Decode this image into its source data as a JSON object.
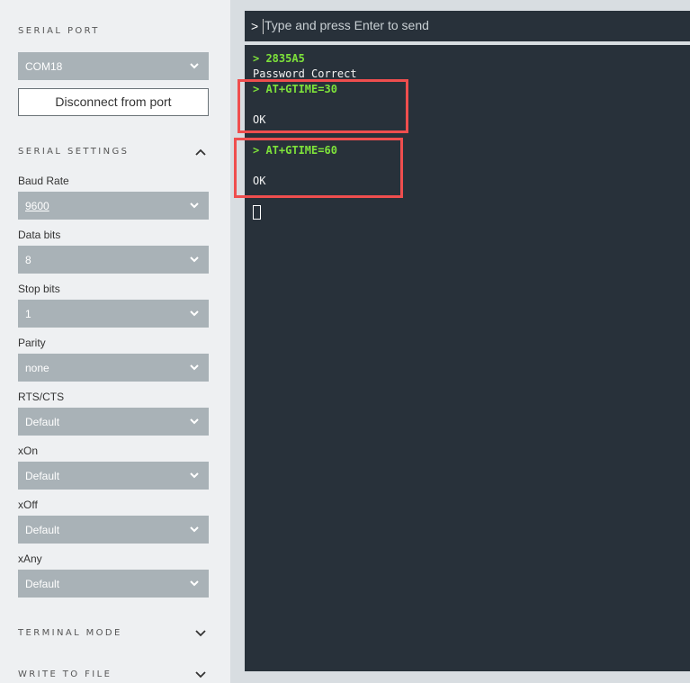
{
  "sidebar": {
    "serial_port": {
      "title": "SERIAL PORT",
      "port_value": "COM18",
      "disconnect_label": "Disconnect from port"
    },
    "serial_settings": {
      "title": "SERIAL SETTINGS",
      "fields": [
        {
          "label": "Baud Rate",
          "value": "9600"
        },
        {
          "label": "Data bits",
          "value": "8"
        },
        {
          "label": "Stop bits",
          "value": "1"
        },
        {
          "label": "Parity",
          "value": "none"
        },
        {
          "label": "RTS/CTS",
          "value": "Default"
        },
        {
          "label": "xOn",
          "value": "Default"
        },
        {
          "label": "xOff",
          "value": "Default"
        },
        {
          "label": "xAny",
          "value": "Default"
        }
      ]
    },
    "terminal_mode": {
      "title": "TERMINAL MODE"
    },
    "write_to_file": {
      "title": "WRITE TO FILE"
    }
  },
  "input": {
    "prompt": ">",
    "placeholder": "Type and press Enter to send"
  },
  "terminal": {
    "lines": [
      {
        "kind": "cmd",
        "text": "> 2835A5"
      },
      {
        "kind": "out",
        "text": "Password Correct"
      },
      {
        "kind": "cmd",
        "text": "> AT+GTIME=30"
      },
      {
        "kind": "out",
        "text": "OK"
      },
      {
        "kind": "cmd",
        "text": "> AT+GTIME=60"
      },
      {
        "kind": "out",
        "text": "OK"
      }
    ]
  },
  "colors": {
    "terminal_bg": "#28313a",
    "command_text": "#7ee23a",
    "highlight_box": "#ef4e4e",
    "select_bg": "#a9b2b7"
  },
  "icons": {
    "chevron_down": "chevron-down-icon",
    "chevron_up": "chevron-up-icon"
  }
}
